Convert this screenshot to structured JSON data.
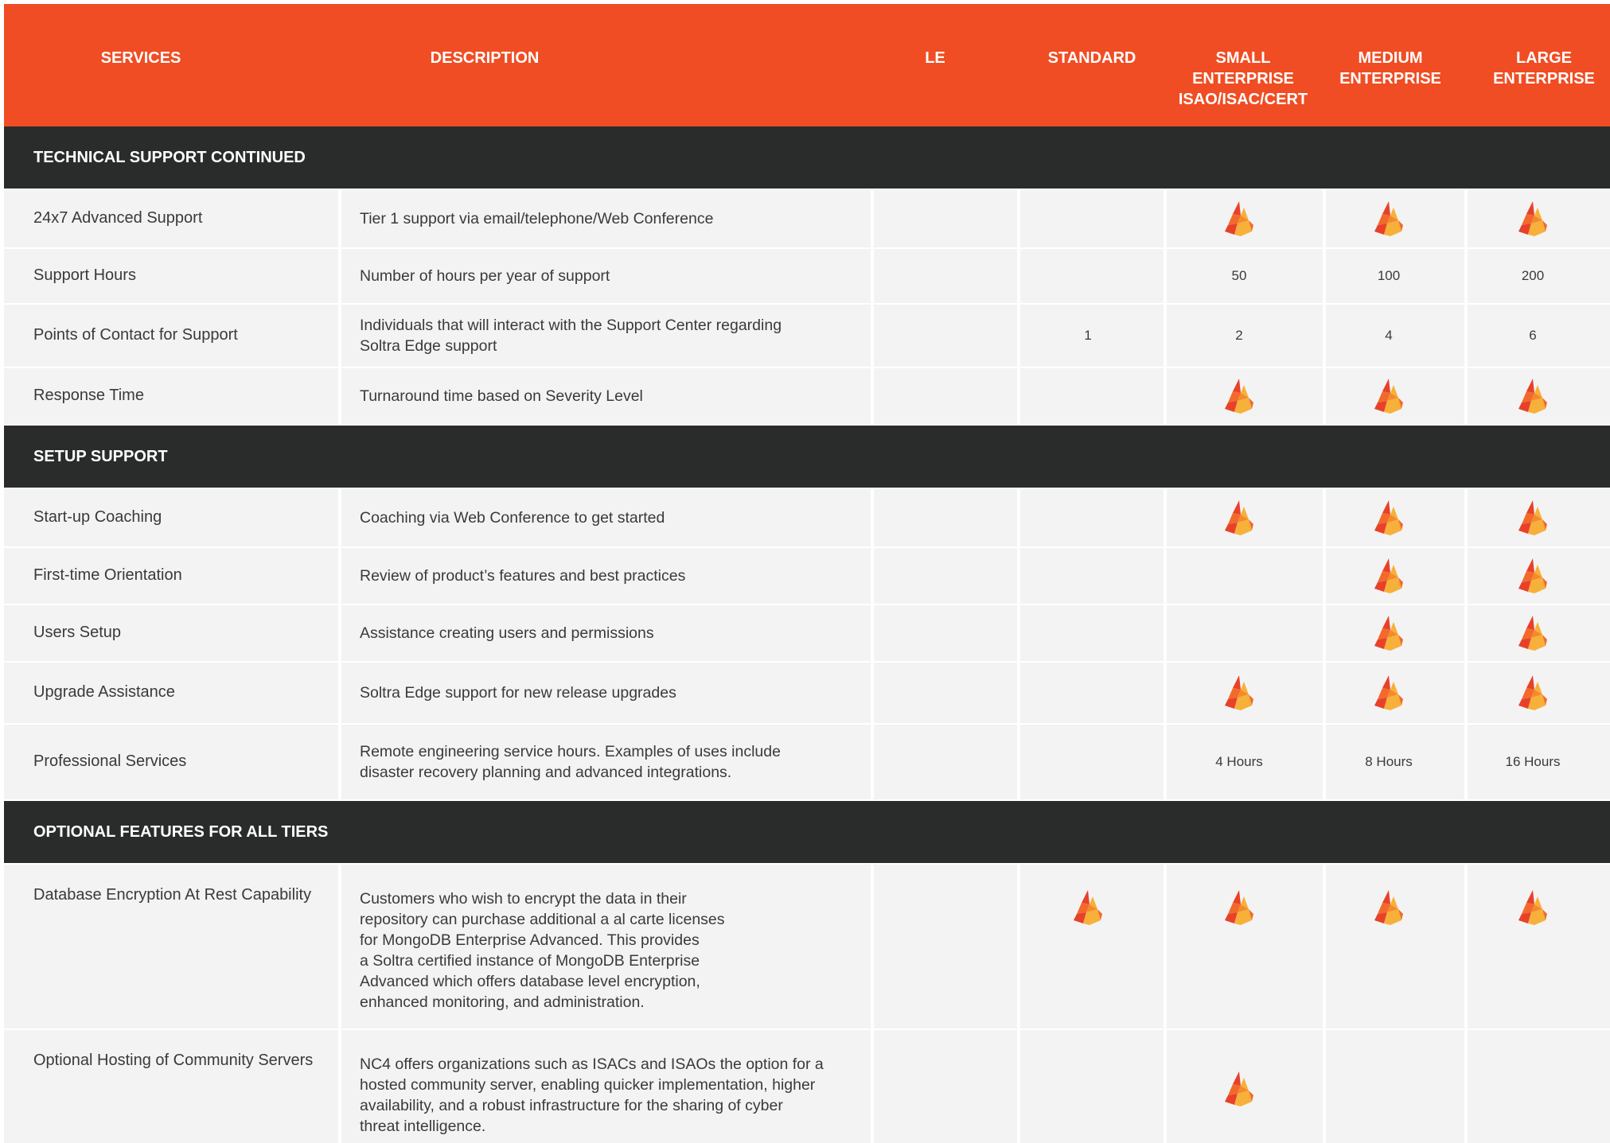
{
  "header": {
    "columns": [
      "SERVICES",
      "DESCRIPTION",
      "LE",
      "STANDARD",
      "SMALL\nENTERPRISE\nISAO/ISAC/CERT",
      "MEDIUM\nENTERPRISE",
      "LARGE\nENTERPRISE"
    ]
  },
  "sections": [
    {
      "title": "TECHNICAL SUPPORT CONTINUED",
      "rows": [
        {
          "service": "24x7 Advanced Support",
          "description": "Tier 1 support via email/telephone/Web Conference",
          "le": "",
          "standard": "",
          "small": "flame",
          "medium": "flame",
          "large": "flame"
        },
        {
          "service": "Support Hours",
          "description": "Number of hours per year of support",
          "le": "",
          "standard": "",
          "small": "50",
          "medium": "100",
          "large": "200"
        },
        {
          "service": "Points of Contact for Support",
          "description": "Individuals that will interact with the Support Center regarding\nSoltra Edge support",
          "le": "",
          "standard": "1",
          "small": "2",
          "medium": "4",
          "large": "6"
        },
        {
          "service": "Response Time",
          "description": "Turnaround time based on Severity Level",
          "le": "",
          "standard": "",
          "small": "flame",
          "medium": "flame",
          "large": "flame"
        }
      ]
    },
    {
      "title": "SETUP SUPPORT",
      "rows": [
        {
          "service": "Start-up Coaching",
          "description": "Coaching via Web Conference to get started",
          "le": "",
          "standard": "",
          "small": "flame",
          "medium": "flame",
          "large": "flame"
        },
        {
          "service": "First-time Orientation",
          "description": "Review of product’s features and best practices",
          "le": "",
          "standard": "",
          "small": "",
          "medium": "flame",
          "large": "flame"
        },
        {
          "service": "Users Setup",
          "description": "Assistance creating users and permissions",
          "le": "",
          "standard": "",
          "small": "",
          "medium": "flame",
          "large": "flame"
        },
        {
          "service": "Upgrade Assistance",
          "description": "Soltra Edge support for new release upgrades",
          "le": "",
          "standard": "",
          "small": "flame",
          "medium": "flame",
          "large": "flame"
        },
        {
          "service": "Professional Services",
          "description": "Remote engineering service hours. Examples of uses include\ndisaster recovery planning and advanced integrations.",
          "le": "",
          "standard": "",
          "small": "4 Hours",
          "medium": "8 Hours",
          "large": "16 Hours"
        }
      ]
    },
    {
      "title": "OPTIONAL FEATURES FOR ALL TIERS",
      "rows": [
        {
          "service": "Database Encryption At Rest Capability",
          "description": "Customers who wish to encrypt the data in their\nrepository can purchase additional a al carte licenses\nfor MongoDB Enterprise Advanced. This provides\na Soltra certified instance of MongoDB Enterprise\nAdvanced which offers database level encryption,\nenhanced monitoring, and administration.",
          "le": "",
          "standard": "flame",
          "small": "flame",
          "medium": "flame",
          "large": "flame"
        },
        {
          "service": "Optional Hosting of Community Servers",
          "description": "NC4 offers organizations such as ISACs and ISAOs the option for a\nhosted community server, enabling quicker implementation, higher\navailability, and a robust infrastructure for the sharing of cyber\nthreat intelligence.",
          "le": "",
          "standard": "",
          "small": "flame",
          "medium": "",
          "large": ""
        }
      ]
    }
  ],
  "colors": {
    "header": "#f04d24",
    "band": "#2a2c2c",
    "cell": "#f3f3f3",
    "flame_dark": "#e8412a",
    "flame_mid": "#f26a2b",
    "flame_light": "#f7b03a"
  },
  "icon": "flame-icon"
}
